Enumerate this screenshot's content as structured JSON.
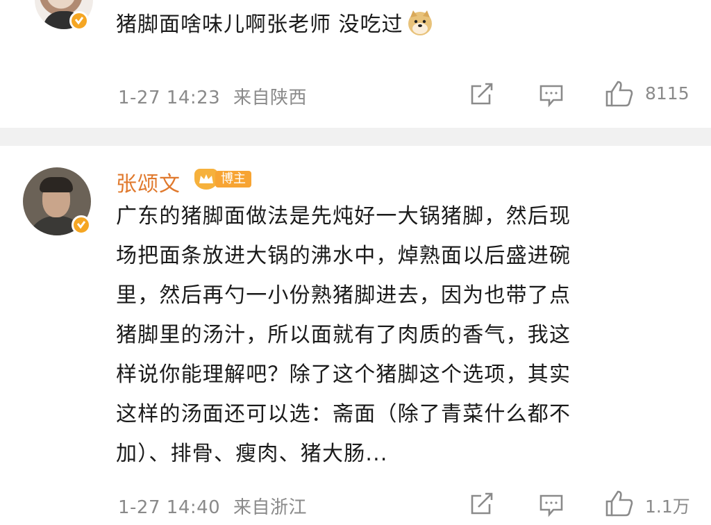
{
  "comment1": {
    "text": "猪脚面啥味儿啊张老师 没吃过",
    "emoji": "doge-emoji",
    "time": "1-27 14:23",
    "location": "来自陕西",
    "likes": "8115"
  },
  "comment2": {
    "author": "张颂文",
    "badge_label": "博主",
    "text_lines": [
      "广东的猪脚面做法是先炖好一大锅猪脚，然后现",
      "场把面条放进大锅的沸水中，焯熟面以后盛进碗",
      "里，然后再勺一小份熟猪脚进去，因为也带了点",
      "猪脚里的汤汁，所以面就有了肉质的香气，我这",
      "样说你能理解吧？除了这个猪脚这个选项，其实",
      "这样的汤面还可以选：斋面（除了青菜什么都不",
      "加）、排骨、瘦肉、猪大肠..."
    ],
    "time": "1-27 14:40",
    "location": "来自浙江",
    "likes": "1.1万"
  },
  "colors": {
    "author": "#e0792d",
    "meta": "#8a8a8a",
    "divider": "#f1f1f1",
    "verified": "#f5a623"
  },
  "icons": [
    "share-icon",
    "comment-icon",
    "like-icon",
    "verified-icon"
  ]
}
